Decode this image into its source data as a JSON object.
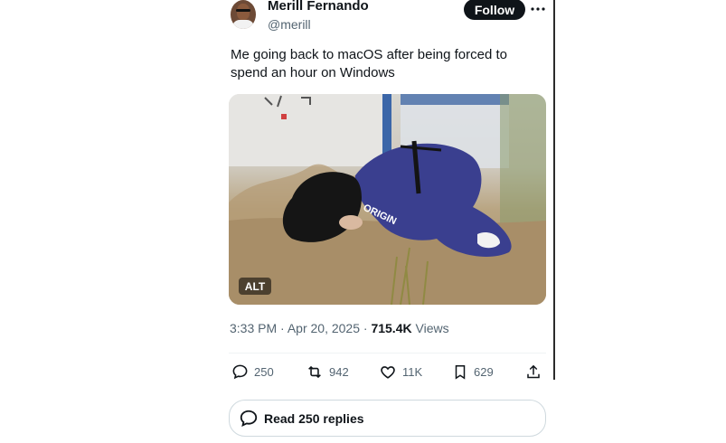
{
  "tweet": {
    "author": {
      "name": "Merill Fernando",
      "handle": "@merill"
    },
    "follow_label": "Follow",
    "more_icon": "more-horizontal-icon",
    "text": "Me going back to macOS after being forced to spend an hour on Windows",
    "media": {
      "alt_badge": "ALT",
      "overlay_text": "ORIGIN"
    },
    "time": "3:33 PM",
    "date": "Apr 20, 2025",
    "views": "715.4K",
    "views_label": "Views",
    "dot": "·"
  },
  "actions": {
    "replies": "250",
    "reposts": "942",
    "likes": "11K",
    "bookmarks": "629"
  },
  "read_replies": {
    "label": "Read 250 replies"
  },
  "colors": {
    "text_primary": "#0f1419",
    "text_secondary": "#536471",
    "follow_bg": "#0f1419",
    "suit_blue": "#3a3f8f",
    "border": "#cfd9de"
  }
}
